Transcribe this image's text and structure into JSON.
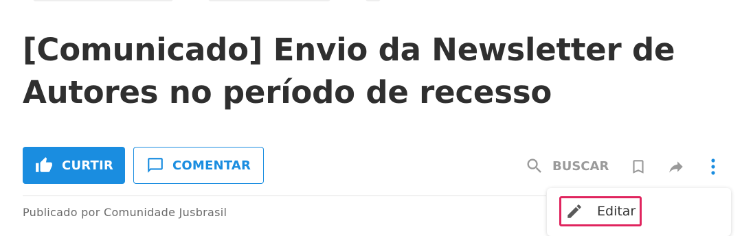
{
  "article": {
    "title": "[Comunicado] Envio da Newsletter de Autores no período de recesso",
    "byline": "Publicado por Comunidade Jusbrasil"
  },
  "actions": {
    "like_label": "CURTIR",
    "comment_label": "COMENTAR",
    "search_label": "BUSCAR"
  },
  "menu": {
    "items": [
      {
        "label": "Editar",
        "icon": "pencil-icon"
      }
    ]
  },
  "colors": {
    "accent": "#1a8de0",
    "title": "#2f2f2f",
    "muted": "#9a9a9a",
    "highlight": "#e0245e"
  }
}
